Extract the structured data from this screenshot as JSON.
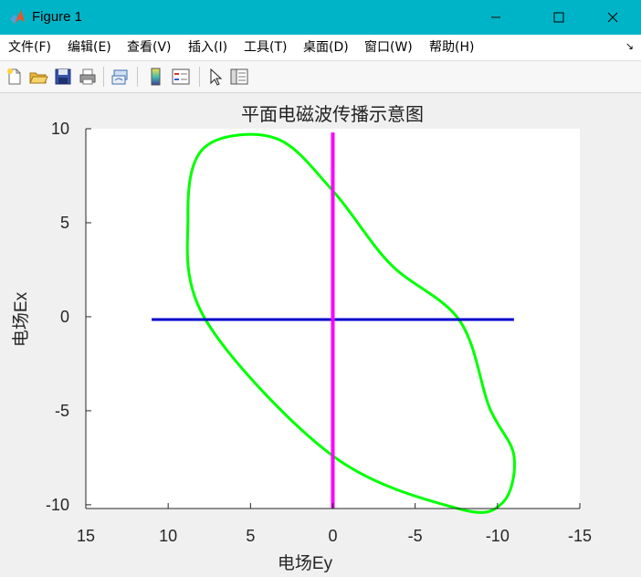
{
  "window": {
    "title": "Figure 1",
    "accent": "#00b4c7"
  },
  "menu": [
    {
      "label": "文件(F)"
    },
    {
      "label": "编辑(E)"
    },
    {
      "label": "查看(V)"
    },
    {
      "label": "插入(I)"
    },
    {
      "label": "工具(T)"
    },
    {
      "label": "桌面(D)"
    },
    {
      "label": "窗口(W)"
    },
    {
      "label": "帮助(H)"
    }
  ],
  "toolbar": {
    "icons": [
      "new-figure-icon",
      "open-file-icon",
      "save-icon",
      "print-icon",
      "link-plot-icon",
      "colorbar-icon",
      "legend-icon",
      "pointer-icon",
      "plot-tools-icon"
    ]
  },
  "chart_data": {
    "type": "line",
    "title": "平面电磁波传播示意图",
    "xlabel": "电场Ey",
    "ylabel": "电场Ex",
    "xlim": [
      15,
      -15
    ],
    "ylim": [
      -10.2,
      10
    ],
    "x_reversed": true,
    "xticks": [
      15,
      10,
      5,
      0,
      -5,
      -10,
      -15
    ],
    "xtick_labels": [
      "15",
      "10",
      "5",
      "0",
      "-5",
      "-10",
      "-15"
    ],
    "yticks": [
      10,
      5,
      0,
      -5,
      -10
    ],
    "ytick_labels": [
      "10",
      "5",
      "0",
      "-5",
      "-10"
    ],
    "grid": false,
    "series": [
      {
        "kind": "ellipse",
        "color": "#00ff00",
        "points": [
          [
            7.7,
            -0.2
          ],
          [
            8.8,
            5.3
          ],
          [
            7.8,
            9.0
          ],
          [
            3.5,
            9.5
          ],
          [
            0,
            6.7
          ],
          [
            -3.5,
            2.8
          ],
          [
            -7.7,
            -0.2
          ],
          [
            -9.5,
            -4.8
          ],
          [
            -11.0,
            -7.4
          ],
          [
            -10.3,
            -9.9
          ],
          [
            -7.6,
            -10.2
          ],
          [
            0,
            -7.4
          ],
          [
            7.7,
            -0.2
          ]
        ]
      },
      {
        "kind": "line",
        "color": "#0000cc",
        "x": [
          11.0,
          -11.0
        ],
        "y": [
          -0.15,
          -0.15
        ]
      },
      {
        "kind": "line",
        "color": "#ff00ff",
        "x": [
          0,
          0
        ],
        "y": [
          -10.2,
          9.8
        ]
      }
    ]
  }
}
